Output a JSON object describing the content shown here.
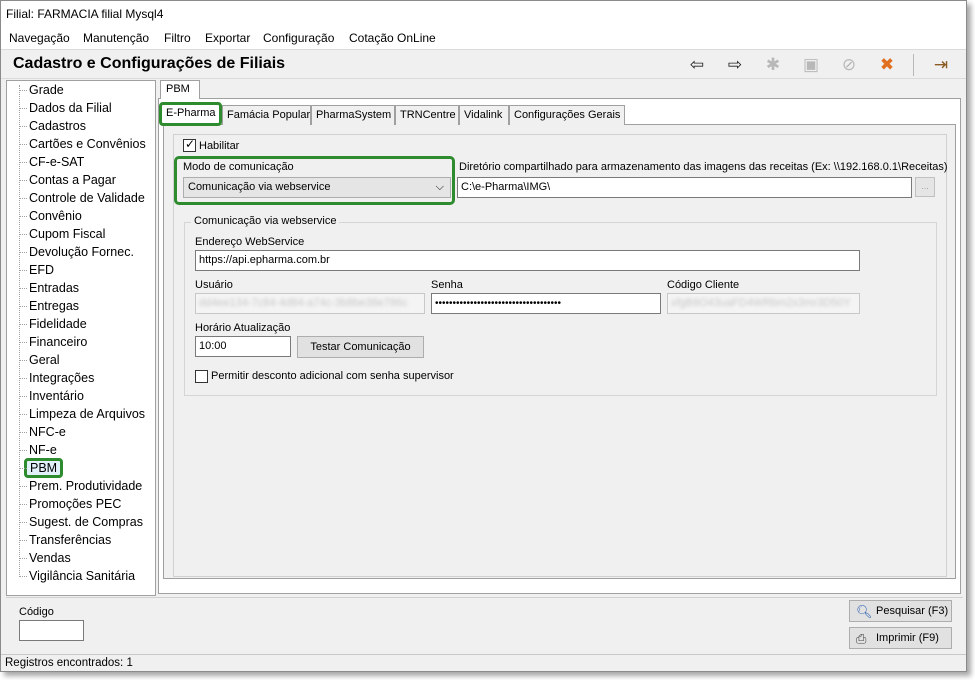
{
  "window": {
    "title": "Filial: FARMACIA filial Mysql4"
  },
  "menu": [
    "Navegação",
    "Manutenção",
    "Filtro",
    "Exportar",
    "Configuração",
    "Cotação OnLine"
  ],
  "header": {
    "title": "Cadastro e Configurações de Filiais"
  },
  "toolbar": {
    "icons": [
      "arrow-left-icon",
      "arrow-right-icon",
      "new-record-icon",
      "save-icon",
      "cancel-icon",
      "delete-icon",
      "exit-icon"
    ]
  },
  "sidebar": {
    "items": [
      "Grade",
      "Dados da Filial",
      "Cadastros",
      "Cartões e Convênios",
      "CF-e-SAT",
      "Contas a Pagar",
      "Controle de Validade",
      "Convênio",
      "Cupom Fiscal",
      "Devolução Fornec.",
      "EFD",
      "Entradas",
      "Entregas",
      "Fidelidade",
      "Financeiro",
      "Geral",
      "Integrações",
      "Inventário",
      "Limpeza de Arquivos",
      "NFC-e",
      "NF-e",
      "PBM",
      "Prem. Produtividade",
      "Promoções PEC",
      "Sugest. de Compras",
      "Transferências",
      "Vendas",
      "Vigilância Sanitária"
    ],
    "selected": "PBM"
  },
  "outer_tab": "PBM",
  "tabs": [
    "E-Pharma",
    "Famácia Popular",
    "PharmaSystem",
    "TRNCentre",
    "Vidalink",
    "Configurações Gerais"
  ],
  "active_tab": "E-Pharma",
  "form": {
    "habilitar_label": "Habilitar",
    "habilitar_checked": true,
    "modo_label": "Modo de comunicação",
    "modo_value": "Comunicação via webservice",
    "diretorio_label": "Diretório compartilhado para armazenamento das imagens das receitas (Ex: \\\\192.168.0.1\\Receitas)",
    "diretorio_value": "C:\\e-Pharma\\IMG\\",
    "browse_label": "...",
    "group_title": "Comunicação via webservice",
    "endereco_label": "Endereço WebService",
    "endereco_value": "https://api.epharma.com.br",
    "usuario_label": "Usuário",
    "usuario_value": "dd4ee134-7c84-4d84-a74c-3b8be38e786c",
    "senha_label": "Senha",
    "senha_value": "••••••••••••••••••••••••••••••••••••",
    "codigo_cliente_label": "Código Cliente",
    "codigo_cliente_value": "xfgB8O43uaFD4WRbm2x3mr3D50Y",
    "horario_label": "Horário Atualização",
    "horario_value": "10:00",
    "testar_button": "Testar Comunicação",
    "permitir_label": "Permitir desconto adicional com senha supervisor",
    "permitir_checked": false
  },
  "bottom": {
    "codigo_label": "Código",
    "codigo_value": "",
    "pesquisar_button": "Pesquisar (F3)",
    "imprimir_button": "Imprimir (F9)"
  },
  "status": "Registros encontrados: 1"
}
